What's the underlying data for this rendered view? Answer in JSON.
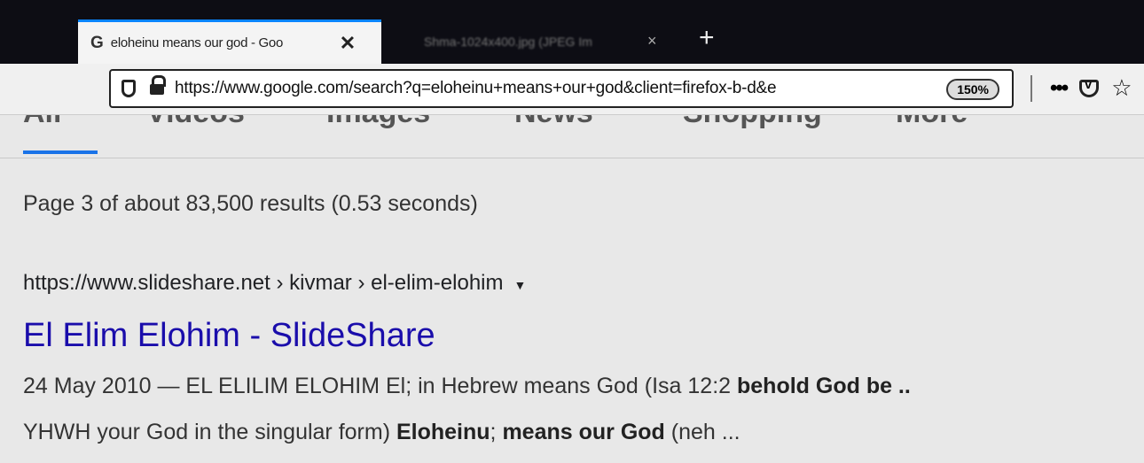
{
  "browser": {
    "active_tab": {
      "favicon": "G",
      "title": "eloheinu means our god - Goo",
      "close": "✕"
    },
    "inactive_tab": {
      "title": "Shma-1024x400.jpg (JPEG Im",
      "close": "×"
    },
    "new_tab": "+",
    "url": "https://www.google.com/search?q=eloheinu+means+our+god&client=firefox-b-d&e",
    "zoom": "150%",
    "menu_dots": "•••",
    "bookmark_star": "☆"
  },
  "google_tabs": [
    "All",
    "Videos",
    "Images",
    "News",
    "Shopping",
    "More"
  ],
  "results_stats": "Page 3 of about 83,500 results (0.53 seconds)",
  "result": {
    "url": "https://www.slideshare.net › kivmar › el-elim-elohim",
    "url_arrow": "▼",
    "title": "El Elim Elohim - SlideShare",
    "snippet_line1": "24 May 2010 — EL ELILIM ELOHIM El; in Hebrew means God (Isa 12:2 ",
    "snippet_line1_bold": "behold God be ..",
    "snippet_line2_a": "YHWH your God in the singular form) ",
    "snippet_line2_b1": "Eloheinu",
    "snippet_line2_c": "; ",
    "snippet_line2_b2": "means our God",
    "snippet_line2_d": " (neh ..."
  },
  "icons": [
    "shield-icon",
    "lock-icon",
    "pocket-icon",
    "star-icon",
    "close-icon",
    "dropdown-arrow-icon"
  ]
}
